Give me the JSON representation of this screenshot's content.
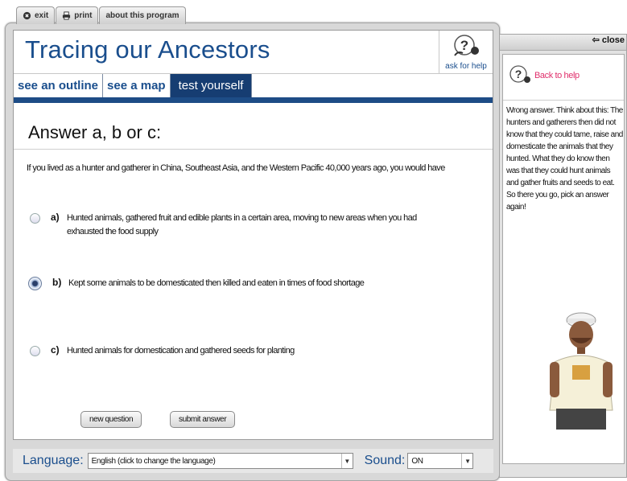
{
  "menu": {
    "exit": "exit",
    "print": "print",
    "about": "about this program"
  },
  "app": {
    "title": "Tracing our Ancestors",
    "help_label": "ask for help"
  },
  "tabs": [
    {
      "label": "see an outline"
    },
    {
      "label": "see a map"
    },
    {
      "label": "test yourself"
    }
  ],
  "question": {
    "heading": "Answer a, b or c:",
    "text": "If you lived as a hunter and gatherer in China, Southeast Asia, and the Western Pacific 40,000 years ago, you would have",
    "options": [
      {
        "letter": "a)",
        "text": "Hunted animals, gathered fruit and edible plants in a certain area, moving to new areas when you had exhausted the food supply",
        "selected": false
      },
      {
        "letter": "b)",
        "text": "Kept some animals to be domesticated then killed and eaten in times of food shortage",
        "selected": true
      },
      {
        "letter": "c)",
        "text": "Hunted animals for domestication and gathered seeds for planting",
        "selected": false
      }
    ]
  },
  "buttons": {
    "new_question": "new question",
    "submit_answer": "submit answer"
  },
  "footer": {
    "language_label": "Language:",
    "language_value": "English (click to change the language)",
    "sound_label": "Sound:",
    "sound_value": "ON"
  },
  "side": {
    "close": "close",
    "back_to_help": "Back to help",
    "feedback": "Wrong answer. Think about this: The hunters and gatherers then did not know that they could tame, raise and domesticate the animals that they hunted. What they do know then was that they could hunt animals and gather fruits and seeds to eat. So there you go, pick an answer again!"
  },
  "colors": {
    "title_blue": "#1a4e8d",
    "tab_active_bg": "#163d72",
    "back_link_pink": "#e0306c"
  }
}
